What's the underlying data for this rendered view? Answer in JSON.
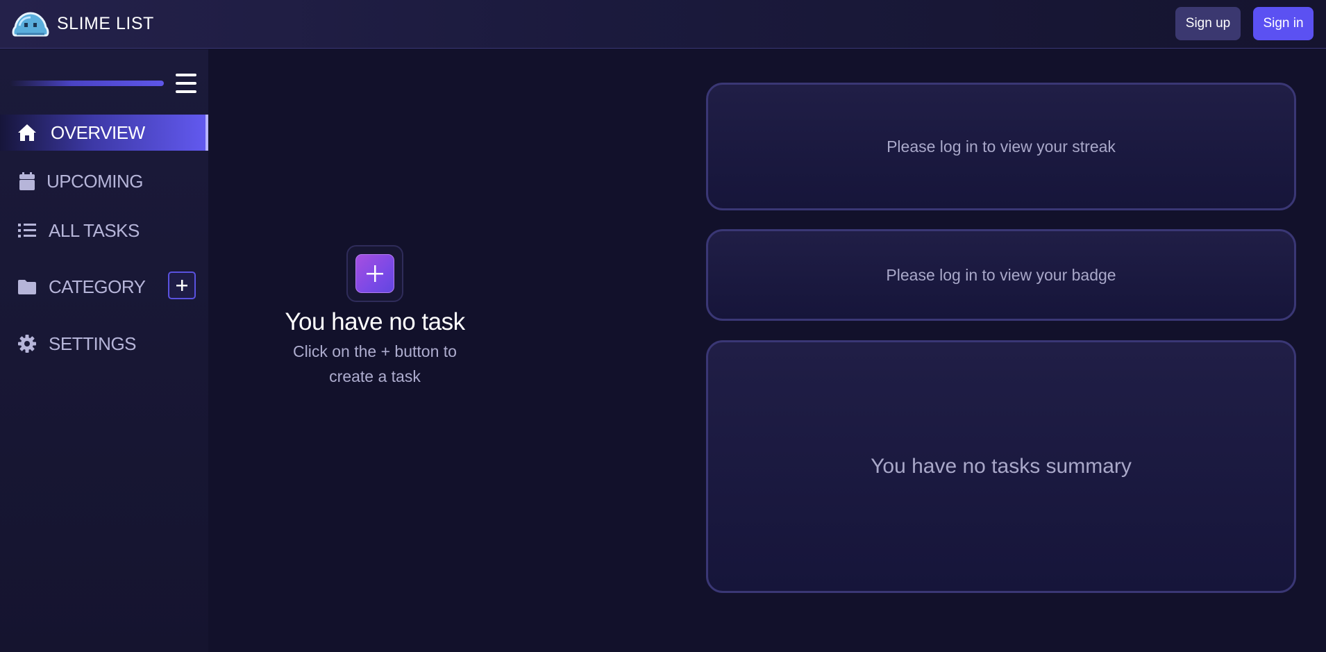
{
  "header": {
    "brand_name": "SLIME LIST",
    "logo_icon": "slime-logo-icon",
    "signup_label": "Sign up",
    "signin_label": "Sign in"
  },
  "sidebar": {
    "menu_icon": "hamburger-icon",
    "items": [
      {
        "label": "OVERVIEW",
        "icon": "home-icon",
        "active": true
      },
      {
        "label": "UPCOMING",
        "icon": "calendar-icon",
        "active": false
      },
      {
        "label": "ALL TASKS",
        "icon": "list-icon",
        "active": false
      },
      {
        "label": "CATEGORY",
        "icon": "folder-icon",
        "active": false
      },
      {
        "label": "SETTINGS",
        "icon": "gear-icon",
        "active": false
      }
    ],
    "add_category_icon": "plus-icon"
  },
  "main": {
    "empty_state": {
      "add_icon": "plus-icon",
      "title": "You have no task",
      "subtitle": "Click on the + button to create a task"
    },
    "cards": {
      "streak": "Please log in to view your streak",
      "badge": "Please log in to view your badge",
      "summary": "You have no tasks summary"
    }
  },
  "colors": {
    "background": "#12112b",
    "accent": "#5b51f2",
    "signup_button": "#3b3870",
    "card_border": "#3a3775",
    "add_task_gradient_start": "#a64fe0"
  }
}
